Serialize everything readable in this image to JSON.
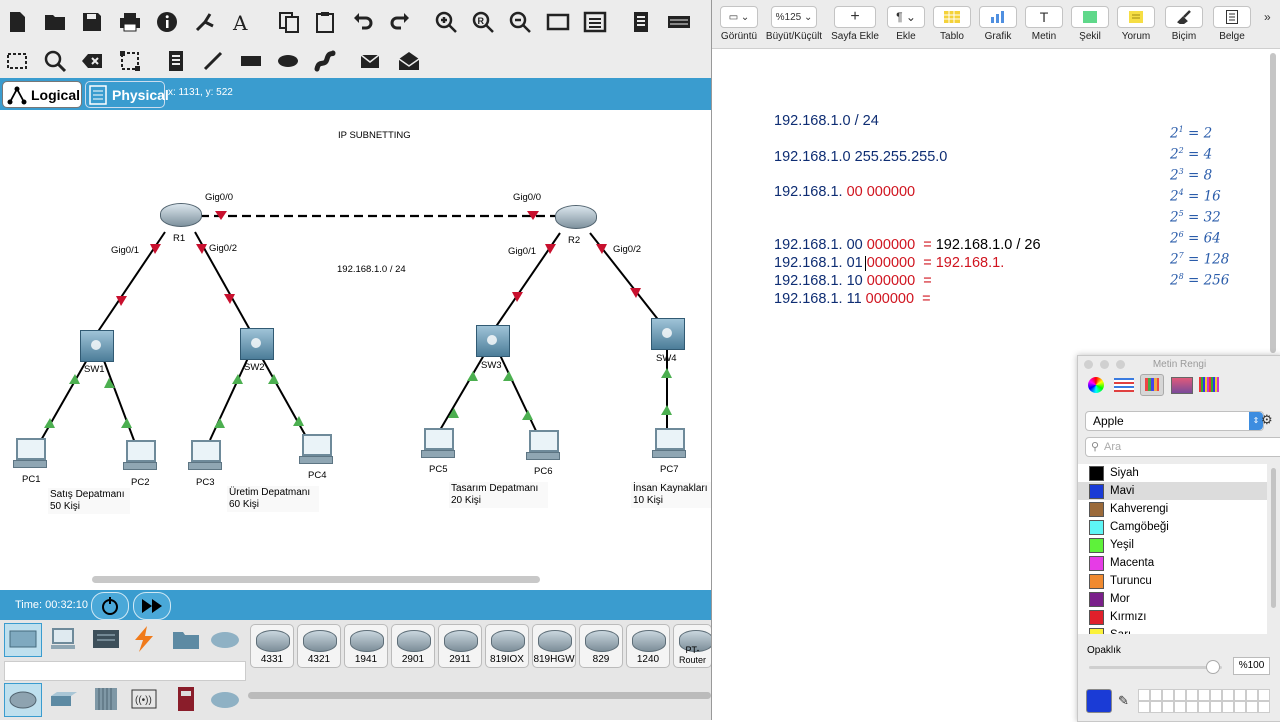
{
  "pt": {
    "tabs": {
      "logical": "Logical",
      "physical": "Physical"
    },
    "coords": "x: 1131, y: 522",
    "canvas": {
      "title": "IP SUBNETTING",
      "network": "192.168.1.0 / 24",
      "routers": [
        {
          "name": "R1"
        },
        {
          "name": "R2"
        }
      ],
      "switches": [
        {
          "name": "SW1"
        },
        {
          "name": "SW2"
        },
        {
          "name": "SW3"
        },
        {
          "name": "SW4"
        }
      ],
      "pcs": [
        "PC1",
        "PC2",
        "PC3",
        "PC4",
        "PC5",
        "PC6",
        "PC7"
      ],
      "ports": {
        "r1_g00": "Gig0/0",
        "r1_g01": "Gig0/1",
        "r1_g02": "Gig0/2",
        "r2_g00": "Gig0/0",
        "r2_g01": "Gig0/1",
        "r2_g02": "Gig0/2"
      },
      "departments": [
        {
          "name": "Satış Depatmanı",
          "count": "50 Kişi"
        },
        {
          "name": "Üretim Depatmanı",
          "count": "60 Kişi"
        },
        {
          "name": "Tasarım Depatmanı",
          "count": "20 Kişi"
        },
        {
          "name": "İnsan Kaynakları",
          "count": "10 Kişi"
        }
      ]
    },
    "time": "Time: 00:32:10",
    "devices": [
      "4331",
      "4321",
      "1941",
      "2901",
      "2911",
      "819IOX",
      "819HGW",
      "829",
      "1240",
      "PT-Router"
    ],
    "colors": {
      "link_red": "#c8102e",
      "link_green": "#4caf50",
      "bar_blue": "#3a9ccf"
    }
  },
  "pages": {
    "toolbar": [
      {
        "label": "Görüntü",
        "button": "▭ ⌄"
      },
      {
        "label": "Büyüt/Küçült",
        "button": "%125 ⌄"
      },
      {
        "label": "Sayfa Ekle",
        "button": "+"
      },
      {
        "label": "Ekle",
        "button": "¶ ⌄"
      },
      {
        "label": "Tablo",
        "button": ""
      },
      {
        "label": "Grafik",
        "button": ""
      },
      {
        "label": "Metin",
        "button": "T"
      },
      {
        "label": "Şekil",
        "button": ""
      },
      {
        "label": "Yorum",
        "button": ""
      },
      {
        "label": "Biçim",
        "button": ""
      },
      {
        "label": "Belge",
        "button": ""
      }
    ],
    "doc": {
      "line1": "192.168.1.0 / 24",
      "line2": "192.168.1.0  255.255.255.0",
      "line3_prefix": "192.168.1. ",
      "line3_red": "00 000000",
      "subnets": [
        {
          "prefix": "192.168.1. ",
          "bits": "00",
          "host": " 000000",
          "eq": "= ",
          "result": "192.168.1.0 / 26"
        },
        {
          "prefix": "192.168.1. ",
          "bits": "01",
          "host": " 000000",
          "eq": "= ",
          "result": "192.168.1."
        },
        {
          "prefix": "192.168.1. ",
          "bits": "10",
          "host": " 000000",
          "eq": "= ",
          "result": ""
        },
        {
          "prefix": "192.168.1. ",
          "bits": "11",
          "host": " 000000",
          "eq": "= ",
          "result": ""
        }
      ],
      "powers": [
        {
          "exp": "1",
          "val": "= 2"
        },
        {
          "exp": "2",
          "val": "= 4"
        },
        {
          "exp": "3",
          "val": "= 8"
        },
        {
          "exp": "4",
          "val": "= 16"
        },
        {
          "exp": "5",
          "val": "= 32"
        },
        {
          "exp": "6",
          "val": "= 64"
        },
        {
          "exp": "7",
          "val": "= 128"
        },
        {
          "exp": "8",
          "val": "= 256"
        }
      ],
      "base": "2"
    }
  },
  "color_panel": {
    "title": "Metin Rengi",
    "palette": "Apple",
    "search_placeholder": "Ara",
    "colors": [
      {
        "name": "Siyah",
        "hex": "#000000"
      },
      {
        "name": "Mavi",
        "hex": "#1a3bd6"
      },
      {
        "name": "Kahverengi",
        "hex": "#9b6a3a"
      },
      {
        "name": "Camgöbeği",
        "hex": "#5ef5f5"
      },
      {
        "name": "Yeşil",
        "hex": "#5ef23a"
      },
      {
        "name": "Macenta",
        "hex": "#e63ce6"
      },
      {
        "name": "Turuncu",
        "hex": "#f08a30"
      },
      {
        "name": "Mor",
        "hex": "#7a1f8a"
      },
      {
        "name": "Kırmızı",
        "hex": "#e0202a"
      },
      {
        "name": "Sarı",
        "hex": "#fbf23a"
      }
    ],
    "selected": "Mavi",
    "opacity_label": "Opaklık",
    "opacity_value": "%100",
    "current_color": "#1a3bd6"
  }
}
